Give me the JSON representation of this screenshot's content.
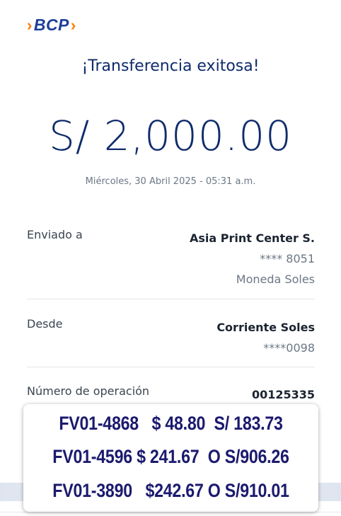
{
  "brand": {
    "name": "BCP"
  },
  "header": {
    "title": "¡Transferencia exitosa!"
  },
  "transfer": {
    "amount": "S/ 2,000.00",
    "datetime": "Miércoles, 30 Abril 2025 - 05:31 a.m."
  },
  "details": {
    "sent_to": {
      "label": "Enviado a",
      "name": "Asia Print Center S.",
      "account": "**** 8051",
      "currency": "Moneda Soles"
    },
    "from": {
      "label": "Desde",
      "account_type": "Corriente Soles",
      "account": "****0098"
    },
    "operation": {
      "label": "Número de operación",
      "number": "00125335"
    }
  },
  "overlay_note": {
    "lines": [
      "FV01-4868   $ 48.80  S/ 183.73",
      "FV01-4596 $ 241.67  O S/906.26",
      "FV01-3890   $242.67 O S/910.01"
    ]
  },
  "colors": {
    "brand_blue": "#1d3f9a",
    "brand_orange": "#ff7a00",
    "amount_text": "#0f2b6b",
    "note_text": "#1b1a6e"
  }
}
